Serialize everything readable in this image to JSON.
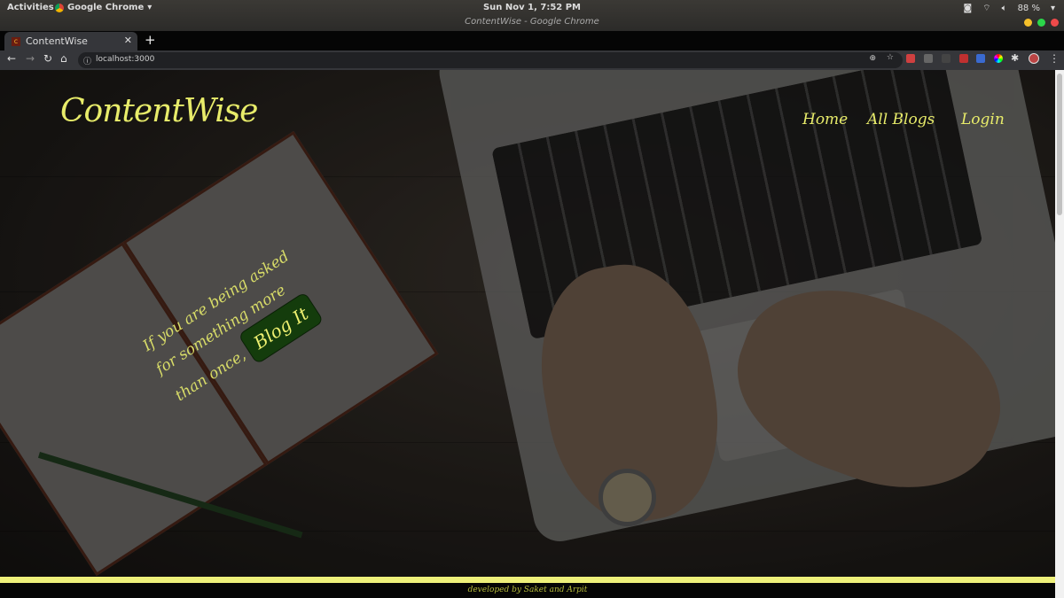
{
  "os": {
    "activities": "Activities",
    "app": "Google Chrome",
    "clock": "Sun Nov  1,  7:52 PM",
    "window_title": "ContentWise - Google Chrome",
    "battery": "88 %"
  },
  "browser": {
    "tab_title": "ContentWise",
    "url": "localhost:3000"
  },
  "site": {
    "logo": "ContentWise",
    "nav": [
      "Home",
      "All Blogs",
      "Login"
    ],
    "hero": {
      "line1": "If you are being asked",
      "line2": "for something more",
      "line3": "than once,",
      "cta": "Blog It"
    },
    "footer": "developed by Saket and Arpit"
  },
  "colors": {
    "accent": "#e8ec6a",
    "cta_bg": "#143c0c"
  }
}
